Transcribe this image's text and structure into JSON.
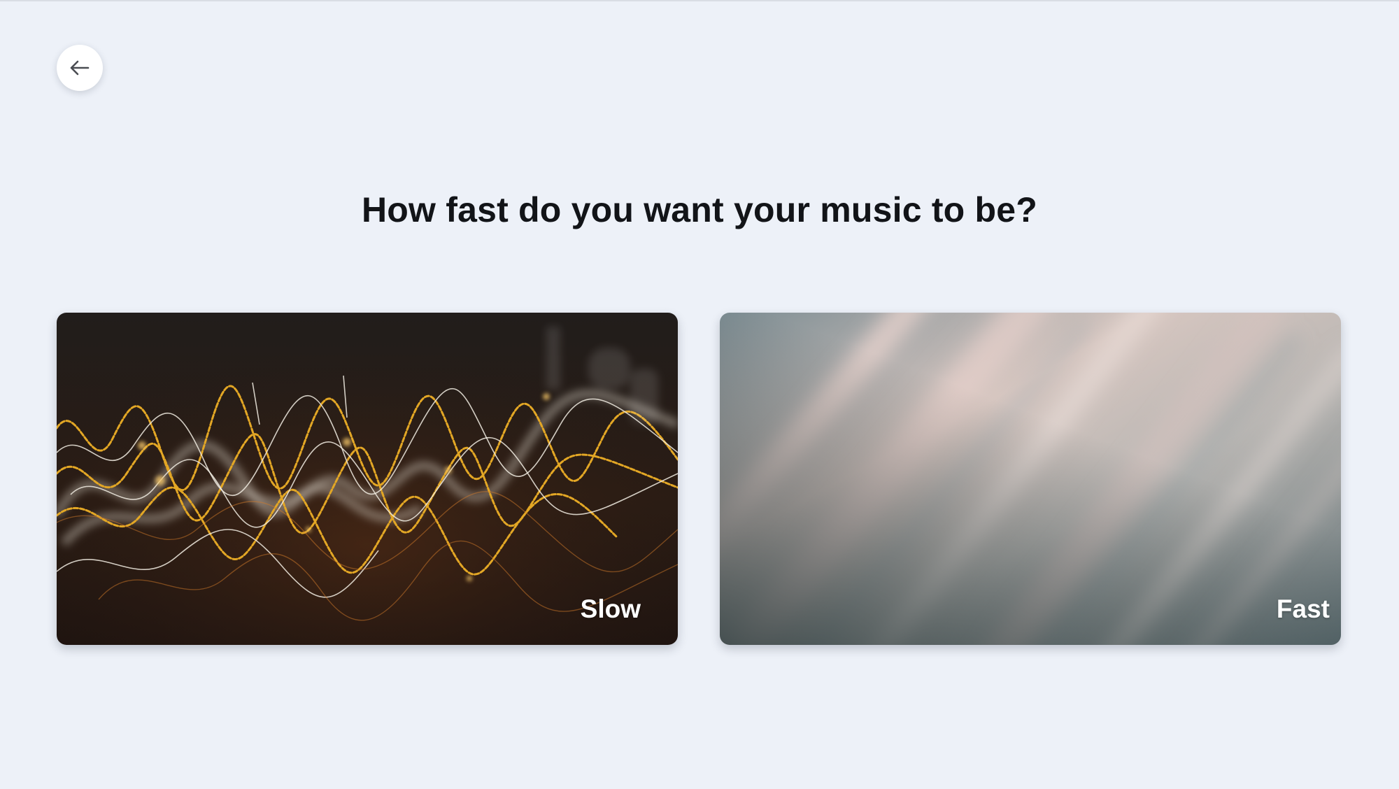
{
  "header": {
    "back_icon": "arrow-left-icon"
  },
  "question": {
    "text": "How fast do you want your music to be?"
  },
  "options": [
    {
      "label": "Slow",
      "image": "light-trails-waves"
    },
    {
      "label": "Fast",
      "image": "motion-blur-streaks"
    }
  ]
}
